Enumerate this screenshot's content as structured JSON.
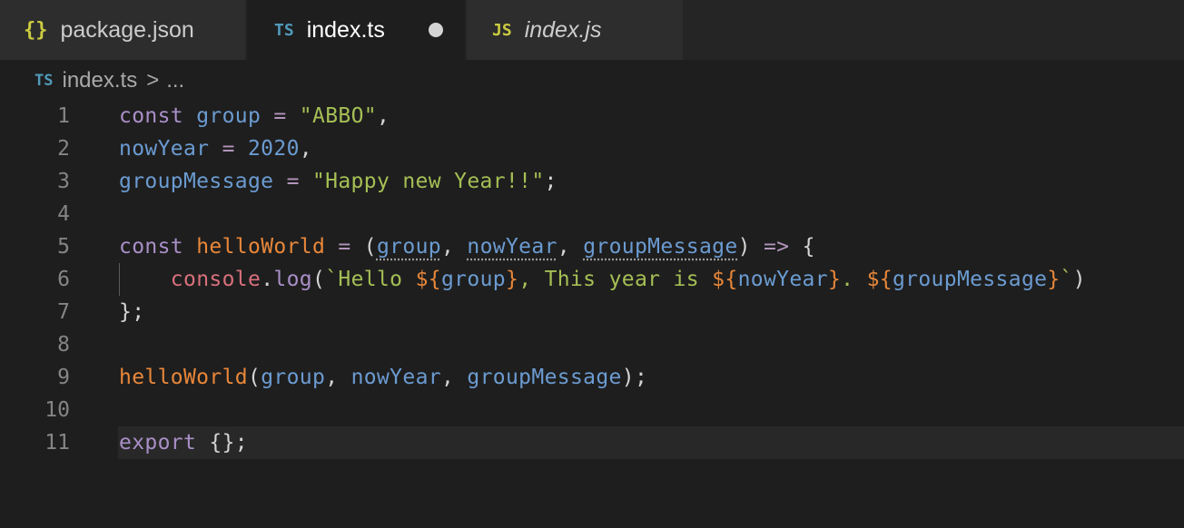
{
  "tabs": [
    {
      "icon": "{}",
      "label": "package.json"
    },
    {
      "icon": "TS",
      "label": "index.ts"
    },
    {
      "icon": "JS",
      "label": "index.js"
    }
  ],
  "breadcrumb": {
    "icon": "TS",
    "file": "index.ts",
    "separator": ">",
    "more": "..."
  },
  "lines": [
    {
      "n": "1"
    },
    {
      "n": "2"
    },
    {
      "n": "3"
    },
    {
      "n": "4"
    },
    {
      "n": "5"
    },
    {
      "n": "6"
    },
    {
      "n": "7"
    },
    {
      "n": "8"
    },
    {
      "n": "9"
    },
    {
      "n": "10"
    },
    {
      "n": "11"
    }
  ],
  "code": {
    "l1": {
      "a": "const",
      "b": " ",
      "c": "group",
      "d": " = ",
      "e": "\"ABBO\"",
      "f": ","
    },
    "l2": {
      "a": "nowYear",
      "b": " = ",
      "c": "2020",
      "d": ","
    },
    "l3": {
      "a": "groupMessage",
      "b": " = ",
      "c": "\"Happy new Year!!\"",
      "d": ";"
    },
    "l5": {
      "a": "const",
      "b": " ",
      "c": "helloWorld",
      "d": " = ",
      "e": "(",
      "f": "group",
      "g": ", ",
      "h": "nowYear",
      "i": ", ",
      "j": "groupMessage",
      "k": ") ",
      "l": "=>",
      "m": " {"
    },
    "l6": {
      "a": "    ",
      "b": "console",
      "c": ".",
      "d": "log",
      "e": "(",
      "f": "`Hello ",
      "g": "${",
      "h": "group",
      "i": "}",
      "j": ", This year is ",
      "k": "${",
      "l": "nowYear",
      "m": "}",
      "n": ". ",
      "o": "${",
      "p": "groupMessage",
      "q": "}",
      "r": "`",
      "s": ")"
    },
    "l7": {
      "a": "};"
    },
    "l9": {
      "a": "helloWorld",
      "b": "(",
      "c": "group",
      "d": ", ",
      "e": "nowYear",
      "f": ", ",
      "g": "groupMessage",
      "h": ");"
    },
    "l11": {
      "a": "export",
      "b": " {};"
    }
  },
  "colors": {
    "background": "#1e1e1e",
    "tab_inactive": "#2d2d2d",
    "keyword": "#b294bb",
    "variable": "#6b9bd1",
    "string": "#a5bf55",
    "function": "#e8873a"
  }
}
